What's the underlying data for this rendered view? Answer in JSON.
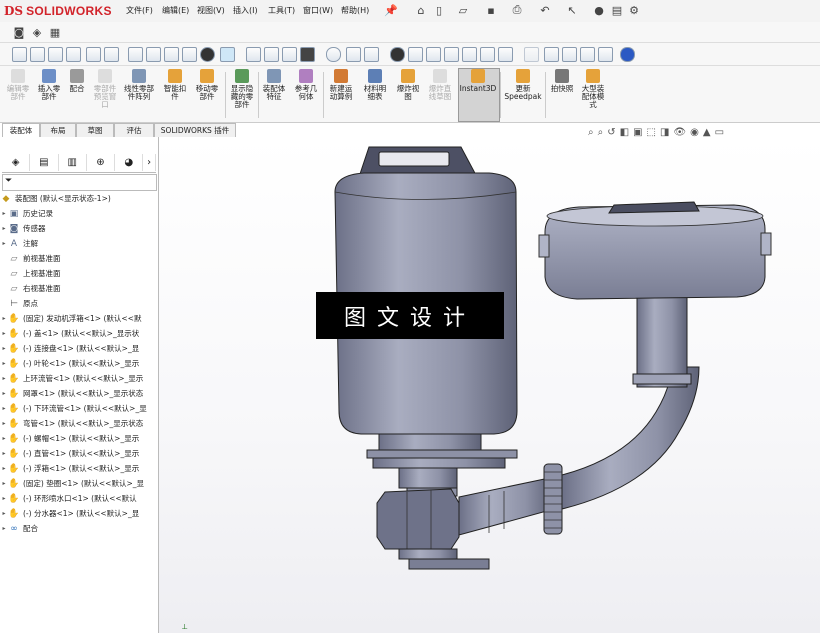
{
  "app": {
    "logo_ds": "DS",
    "logo_name": "SOLIDWORKS"
  },
  "menu": {
    "items": [
      "文件(F)",
      "编辑(E)",
      "视图(V)",
      "插入(I)",
      "工具(T)",
      "窗口(W)",
      "帮助(H)"
    ]
  },
  "command_manager": {
    "buttons": [
      {
        "label": "编辑零\n部件",
        "enabled": false
      },
      {
        "label": "插入零\n部件",
        "enabled": true
      },
      {
        "label": "配合",
        "enabled": true
      },
      {
        "label": "零部件\n预览窗\n口",
        "enabled": false
      },
      {
        "label": "线性零部\n件阵列",
        "enabled": true
      },
      {
        "label": "智能扣\n件",
        "enabled": true
      },
      {
        "label": "移动零\n部件",
        "enabled": true
      },
      {
        "label": "显示隐\n藏的零\n部件",
        "enabled": true
      },
      {
        "label": "装配体\n特征",
        "enabled": true
      },
      {
        "label": "参考几\n何体",
        "enabled": true
      },
      {
        "label": "新建运\n动算例",
        "enabled": true
      },
      {
        "label": "材料明\n细表",
        "enabled": true
      },
      {
        "label": "爆炸视\n图",
        "enabled": true
      },
      {
        "label": "爆炸直\n线草图",
        "enabled": false
      },
      {
        "label": "Instant3D",
        "enabled": true
      },
      {
        "label": "更新\nSpeedpak",
        "enabled": true
      },
      {
        "label": "拍快照",
        "enabled": true
      },
      {
        "label": "大型装\n配体模\n式",
        "enabled": true
      }
    ]
  },
  "tabs": [
    "装配体",
    "布局",
    "草图",
    "评估",
    "SOLIDWORKS 插件"
  ],
  "tree": {
    "root": "装配图 (默认<显示状态-1>)",
    "items": [
      {
        "label": "历史记录",
        "icon": "history-icon"
      },
      {
        "label": "传感器",
        "icon": "sensor-icon"
      },
      {
        "label": "注解",
        "icon": "annotation-icon"
      },
      {
        "label": "前视基准面",
        "icon": "plane-icon"
      },
      {
        "label": "上视基准面",
        "icon": "plane-icon"
      },
      {
        "label": "右视基准面",
        "icon": "plane-icon"
      },
      {
        "label": "原点",
        "icon": "origin-icon"
      },
      {
        "label": "(固定) 发动机浮箱<1> (默认<<默",
        "icon": "part-icon"
      },
      {
        "label": "(-) 盖<1> (默认<<默认>_显示状",
        "icon": "part-icon"
      },
      {
        "label": "(-) 连接盘<1> (默认<<默认>_显",
        "icon": "part-icon"
      },
      {
        "label": "(-) 叶轮<1> (默认<<默认>_显示",
        "icon": "part-icon"
      },
      {
        "label": "上环流管<1> (默认<<默认>_显示",
        "icon": "part-icon"
      },
      {
        "label": "网罩<1> (默认<<默认>_显示状态",
        "icon": "part-icon"
      },
      {
        "label": "(-) 下环流管<1> (默认<<默认>_显",
        "icon": "part-icon"
      },
      {
        "label": "弯管<1> (默认<<默认>_显示状态",
        "icon": "part-icon"
      },
      {
        "label": "(-) 螺帽<1> (默认<<默认>_显示",
        "icon": "part-icon"
      },
      {
        "label": "(-) 直管<1> (默认<<默认>_显示",
        "icon": "part-icon"
      },
      {
        "label": "(-) 浮箱<1> (默认<<默认>_显示",
        "icon": "part-icon"
      },
      {
        "label": "(固定) 垫圈<1> (默认<<默认>_显",
        "icon": "part-icon"
      },
      {
        "label": "(-) 环形喷水口<1> (默认<<默认",
        "icon": "part-icon"
      },
      {
        "label": "(-) 分水器<1> (默认<<默认>_显",
        "icon": "part-icon"
      },
      {
        "label": "配合",
        "icon": "mates-icon"
      }
    ]
  },
  "banner": {
    "text": "图文设计"
  },
  "colors": {
    "accent": "#d2232a",
    "model": "#8e93a8",
    "model_dark": "#5d6175",
    "background": "#ffffff"
  }
}
